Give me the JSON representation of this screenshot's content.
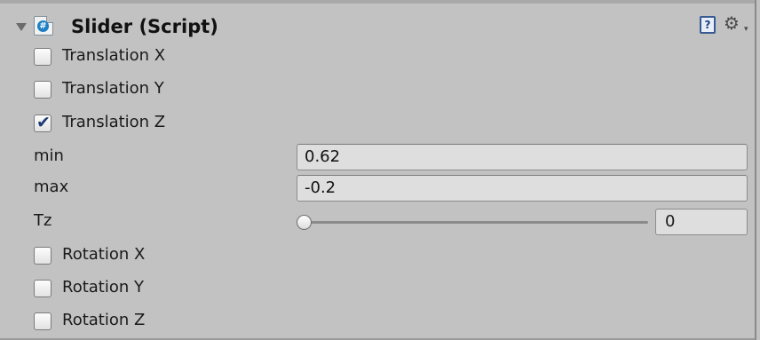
{
  "component": {
    "title": "Slider (Script)",
    "help_icon_glyph": "?",
    "gear_icon_glyph": "⚙",
    "gear_caret_glyph": "▾",
    "script_icon_glyph": "#"
  },
  "properties": {
    "translation_x": {
      "label": "Translation X",
      "checked": false
    },
    "translation_y": {
      "label": "Translation Y",
      "checked": false
    },
    "translation_z": {
      "label": "Translation Z",
      "checked": true,
      "check_glyph": "✔"
    },
    "min": {
      "label": "min",
      "value": "0.62"
    },
    "max": {
      "label": "max",
      "value": "-0.2"
    },
    "tz": {
      "label": "Tz",
      "value": "0",
      "slider_fraction": 0
    },
    "rotation_x": {
      "label": "Rotation X",
      "checked": false
    },
    "rotation_y": {
      "label": "Rotation Y",
      "checked": false
    },
    "rotation_z": {
      "label": "Rotation Z",
      "checked": false
    }
  }
}
